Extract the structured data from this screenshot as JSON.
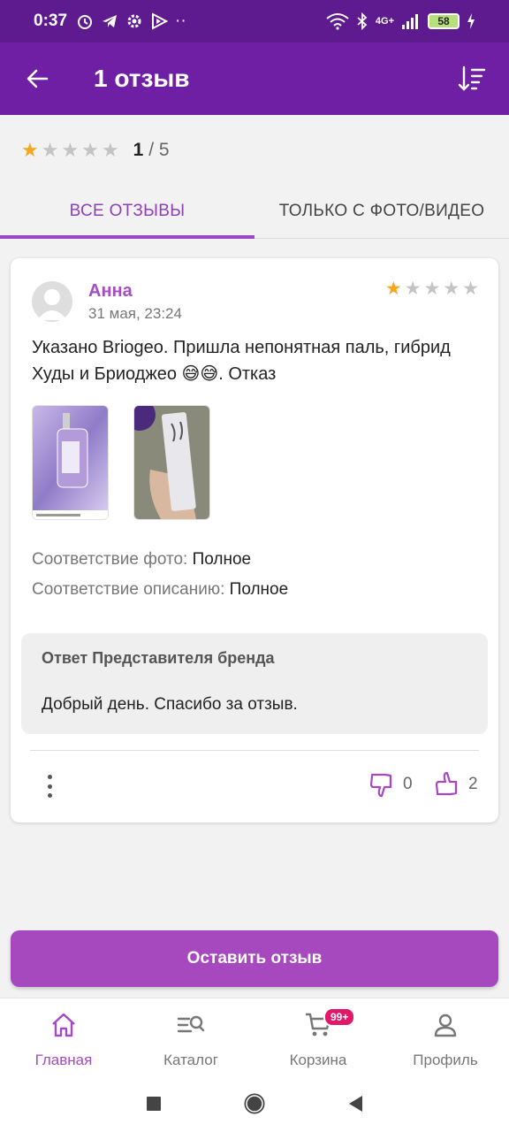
{
  "status_bar": {
    "time": "0:37",
    "network": "4G+",
    "battery": "58",
    "icons": [
      "alarm-icon",
      "telegram-icon",
      "settings-icon",
      "play-icon",
      "more-dots-icon",
      "wifi-icon",
      "bluetooth-icon",
      "signal-icon",
      "battery-icon",
      "charging-icon"
    ]
  },
  "app_bar": {
    "title": "1 отзыв",
    "back_icon": "arrow-back-icon",
    "sort_icon": "sort-icon"
  },
  "summary": {
    "rating_value": "1",
    "rating_max": "/ 5",
    "stars_filled": 1,
    "stars_total": 5
  },
  "tabs": [
    {
      "label": "ВСЕ ОТЗЫВЫ",
      "active": true
    },
    {
      "label": "ТОЛЬКО С ФОТО/ВИДЕО",
      "active": false
    }
  ],
  "review": {
    "author": "Анна",
    "date": "31 мая, 23:24",
    "stars_filled": 1,
    "text": "Указано Briogeo. Пришла непонятная паль, гибрид Худы и Бриоджео 😅😅. Отказ",
    "photos": [
      "product-photo-1",
      "product-photo-2"
    ],
    "attributes": [
      {
        "label": "Соответствие фото:",
        "value": "Полное"
      },
      {
        "label": "Соответствие описанию:",
        "value": "Полное"
      }
    ],
    "brand_reply": {
      "title": "Ответ Представителя бренда",
      "text": "Добрый день. Спасибо за отзыв."
    },
    "dislikes": "0",
    "likes": "2"
  },
  "leave_review_button": "Оставить отзыв",
  "bottom_nav": [
    {
      "label": "Главная",
      "icon": "home-icon",
      "active": true
    },
    {
      "label": "Каталог",
      "icon": "catalog-search-icon",
      "active": false
    },
    {
      "label": "Корзина",
      "icon": "cart-icon",
      "active": false,
      "badge": "99+"
    },
    {
      "label": "Профиль",
      "icon": "profile-icon",
      "active": false
    }
  ],
  "colors": {
    "accent": "#a649bf",
    "app_bar": "#6e1fa3",
    "status_bar": "#5e1a8f",
    "star_on": "#f5a623",
    "star_off": "#c4c4c4"
  }
}
